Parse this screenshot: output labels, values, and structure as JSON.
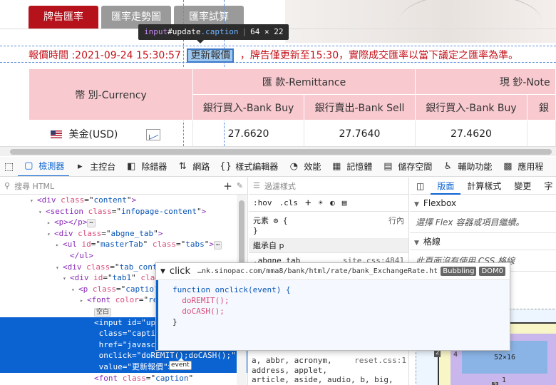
{
  "tabs": [
    "牌告匯率",
    "匯率走勢圖",
    "匯率試算"
  ],
  "inspector_tooltip": {
    "element": "input",
    "id": "#update",
    "class": ".caption",
    "size": "64 × 22"
  },
  "notice": {
    "prefix": "報價時間 :2021-09-24 15:30:57",
    "button_label": "更新報價",
    "suffix": "，牌告僅更新至15:30，實際成交匯率以當下議定之匯率為準。"
  },
  "table": {
    "currency_header": "幣 別-Currency",
    "remittance_header": "匯 款-Remittance",
    "notes_header": "現 鈔-Note",
    "col_buy": "銀行買入-Bank Buy",
    "col_sell": "銀行賣出-Bank Sell",
    "col_buy2": "銀行買入-Bank Buy",
    "col_cut": "銀",
    "row_currency": "美金(USD)",
    "row_values": [
      "27.6620",
      "27.7640",
      "27.4620"
    ]
  },
  "devtools": {
    "tools": [
      {
        "icon": "▢",
        "label": "檢測器"
      },
      {
        "icon": "▸",
        "label": "主控台"
      },
      {
        "icon": "◧",
        "label": "除錯器"
      },
      {
        "icon": "⇅",
        "label": "網路"
      },
      {
        "icon": "{}",
        "label": "樣式編輯器"
      },
      {
        "icon": "◔",
        "label": "效能"
      },
      {
        "icon": "▦",
        "label": "記憶體"
      },
      {
        "icon": "▤",
        "label": "儲存空間"
      },
      {
        "icon": "♿",
        "label": "輔助功能"
      },
      {
        "icon": "▩",
        "label": "應用程"
      }
    ],
    "search_placeholder": "搜尋 HTML",
    "filter_placeholder": "過濾樣式",
    "rules_bar": [
      ":hov",
      ".cls"
    ],
    "element_rule": {
      "selector": "元素",
      "brace": "{",
      "src": "行內",
      "close": "}"
    },
    "inherited_label": "繼承自 p",
    "abgne_rule": {
      "selector": ".abgne_tab",
      "src": "site.css:4841"
    },
    "reset_rule": {
      "line1": "a, abbr, acronym,",
      "src": "reset.css:1",
      "line2": "address, applet,",
      "line3": "article, aside, audio, b, big,"
    },
    "right_tabs": [
      "版面",
      "計算樣式",
      "變更",
      "字"
    ],
    "flexbox_label": "Flexbox",
    "flexbox_hint": "選擇 Flex 容器或項目繼續。",
    "grid_label": "格線",
    "grid_hint": "此頁面沒有使用 CSS 格線",
    "box": {
      "margin": "0",
      "border": "2",
      "padding_l": "4",
      "border_l": "2",
      "content": "52×16",
      "padding_b": "1",
      "border_b": "2"
    }
  },
  "tree": [
    {
      "indent": 52,
      "twist": "▾",
      "open": "<div",
      "attr": "class",
      "val": "content",
      "close": ">"
    },
    {
      "indent": 64,
      "twist": "▾",
      "open": "<section",
      "attr": "class",
      "val": "infopage-content",
      "close": ">"
    },
    {
      "indent": 76,
      "twist": "▸",
      "open": "<p>",
      "badge": "⋯",
      "close": "</p>"
    },
    {
      "indent": 76,
      "twist": "▾",
      "open": "<div",
      "attr": "class",
      "val": "abgne_tab",
      "close": ">"
    },
    {
      "indent": 88,
      "twist": "▸",
      "open": "<ul",
      "attr": "id",
      "val": "masterTab",
      "attr2": "class",
      "val2": "tabs",
      "close": ">",
      "badge": "⋯"
    },
    {
      "indent": 98,
      "twist": "",
      "open": "</ul>"
    },
    {
      "indent": 88,
      "twist": "▾",
      "open": "<div",
      "attr": "class",
      "val": "tab_cont"
    },
    {
      "indent": 98,
      "twist": "▾",
      "open": "<div",
      "attr": "id",
      "val": "tab1",
      "attr2": "cla"
    },
    {
      "indent": 110,
      "twist": "▾",
      "open": "<p",
      "attr": "class",
      "val": "captio"
    },
    {
      "indent": 122,
      "twist": "▸",
      "open": "<font",
      "attr": "color",
      "val": "re"
    },
    {
      "indent": 132,
      "twist": "",
      "badge": "空白"
    },
    {
      "indent": 132,
      "twist": "",
      "open": "<input",
      "attr": "id",
      "val": "upda",
      "sel": true
    },
    {
      "indent": 132,
      "twist": "",
      "attr": "class",
      "val": "caption",
      "sel": true
    },
    {
      "indent": 132,
      "twist": "",
      "attr": "href",
      "val": "javascrip",
      "sel": true
    },
    {
      "indent": 132,
      "twist": "",
      "attr": "onclick",
      "val": "doREMIT();doCASH();",
      "sel": true
    },
    {
      "indent": 132,
      "twist": "",
      "attr": "value",
      "val": "更新報價",
      "close": ">",
      "sel": true
    },
    {
      "indent": 132,
      "twist": "",
      "open": "<font",
      "attr": "class",
      "val": "caption"
    }
  ],
  "event_popup": {
    "event_name": "click",
    "url": "…nk.sinopac.com/mma8/bank/html/rate/bank_ExchangeRate.html",
    "badge1": "Bubbling",
    "badge2": "DOM0",
    "code": [
      "function onclick(event) {",
      "  doREMIT();",
      "  doCASH();",
      "}"
    ],
    "tag_label": "event"
  }
}
